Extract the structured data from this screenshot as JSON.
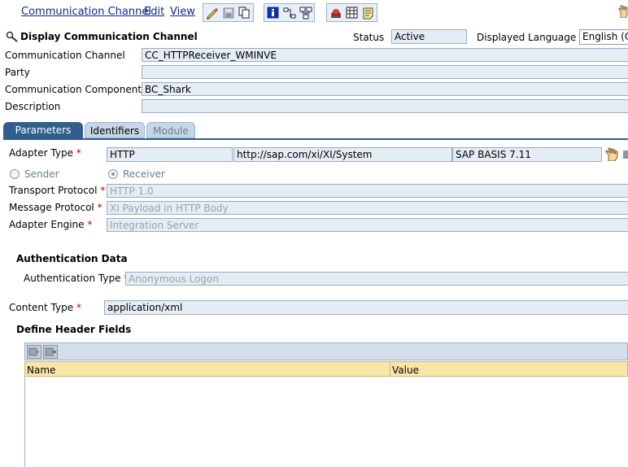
{
  "menu": {
    "items": [
      "Communication Channel",
      "Edit",
      "View"
    ]
  },
  "toolbar": {
    "icons": [
      "edit-pencil-icon",
      "save-icon",
      "copy-icon",
      "info-icon",
      "navigate-icon",
      "where-used-icon",
      "cache-icon",
      "table-icon",
      "log-icon"
    ]
  },
  "header": {
    "title": "Display Communication Channel",
    "status_label": "Status",
    "status_value": "Active",
    "lang_label": "Displayed Language",
    "lang_value": "English (O",
    "channel_label": "Communication Channel",
    "channel_value": "CC_HTTPReceiver_WMINVE",
    "party_label": "Party",
    "party_value": "",
    "component_label": "Communication Component",
    "component_value": "BC_Shark",
    "description_label": "Description",
    "description_value": ""
  },
  "tabs": [
    {
      "label": "Parameters",
      "state": "active"
    },
    {
      "label": "Identifiers",
      "state": "normal"
    },
    {
      "label": "Module",
      "state": "disabled"
    }
  ],
  "params": {
    "adapter_type_label": "Adapter Type",
    "adapter_type_value": "HTTP",
    "adapter_namespace": "http://sap.com/xi/XI/System",
    "adapter_swcv": "SAP BASIS 7.11",
    "sender_label": "Sender",
    "receiver_label": "Receiver",
    "selected_direction": "Receiver",
    "transport_label": "Transport Protocol",
    "transport_value": "HTTP 1.0",
    "message_label": "Message Protocol",
    "message_value": "XI Payload in HTTP Body",
    "engine_label": "Adapter Engine",
    "engine_value": "Integration Server",
    "required_mark": "*"
  },
  "auth": {
    "section_title": "Authentication Data",
    "type_label": "Authentication Type",
    "type_value": "Anonymous Logon"
  },
  "content": {
    "type_label": "Content Type",
    "type_value": "application/xml"
  },
  "headers_table": {
    "section_title": "Define Header Fields",
    "columns": [
      "Name",
      "Value"
    ]
  },
  "colors": {
    "accent": "#315e8c",
    "menu_text": "#10288c",
    "field_bg": "#e4ecf4",
    "table_header": "#f7e6a8",
    "required": "#c00000"
  }
}
